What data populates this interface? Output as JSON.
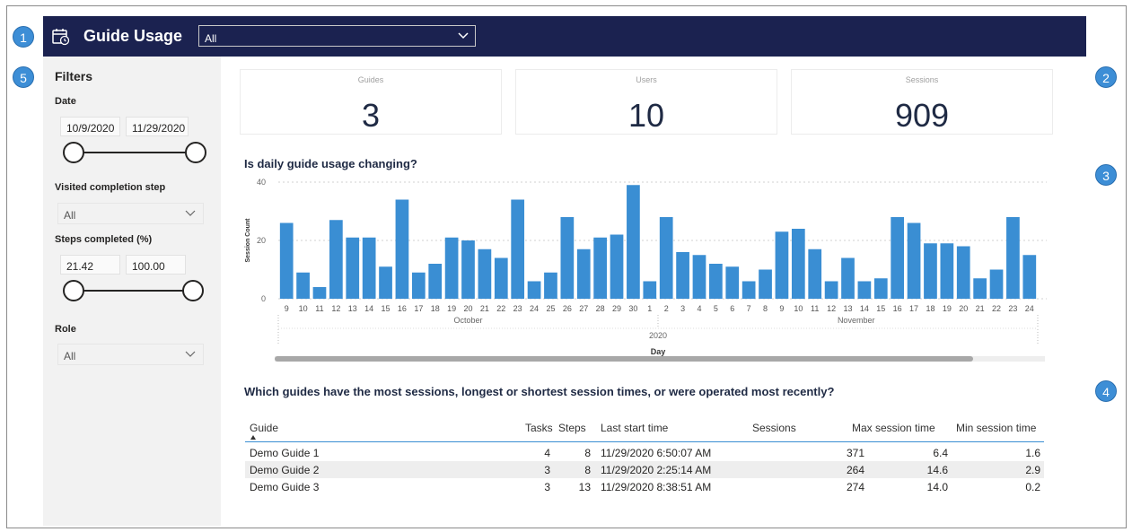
{
  "badges": [
    "1",
    "5",
    "2",
    "3",
    "4"
  ],
  "header": {
    "title": "Guide Usage",
    "select_value": "All"
  },
  "filters": {
    "title": "Filters",
    "date": {
      "label": "Date",
      "start": "10/9/2020",
      "end": "11/29/2020"
    },
    "visited": {
      "label": "Visited completion step",
      "value": "All"
    },
    "steps": {
      "label": "Steps completed (%)",
      "min": "21.42",
      "max": "100.00"
    },
    "role": {
      "label": "Role",
      "value": "All"
    }
  },
  "cards": [
    {
      "label": "Guides",
      "value": "3"
    },
    {
      "label": "Users",
      "value": "10"
    },
    {
      "label": "Sessions",
      "value": "909"
    }
  ],
  "chart_section": {
    "title": "Is daily guide usage changing?"
  },
  "chart_data": {
    "type": "bar",
    "ylabel": "Session Count",
    "xlabel": "Day",
    "ylim": [
      0,
      40
    ],
    "yticks": [
      0,
      20,
      40
    ],
    "grid": true,
    "year_label": "2020",
    "months": [
      {
        "label": "October",
        "from": 0,
        "to": 22
      },
      {
        "label": "November",
        "from": 23,
        "to": 46
      }
    ],
    "categories": [
      "9",
      "10",
      "11",
      "12",
      "13",
      "14",
      "15",
      "16",
      "17",
      "18",
      "19",
      "20",
      "21",
      "22",
      "23",
      "24",
      "25",
      "26",
      "27",
      "28",
      "29",
      "30",
      "1",
      "2",
      "3",
      "4",
      "5",
      "6",
      "7",
      "8",
      "9",
      "10",
      "11",
      "12",
      "13",
      "14",
      "15",
      "16",
      "17",
      "18",
      "19",
      "20",
      "21",
      "22",
      "23",
      "24"
    ],
    "values": [
      26,
      9,
      4,
      27,
      21,
      21,
      11,
      34,
      9,
      12,
      21,
      20,
      17,
      14,
      34,
      6,
      9,
      28,
      17,
      21,
      22,
      39,
      6,
      28,
      16,
      15,
      12,
      11,
      6,
      10,
      23,
      24,
      17,
      6,
      14,
      6,
      7,
      28,
      26,
      19,
      19,
      18,
      7,
      10,
      28,
      15
    ],
    "color": "#3a8ed3"
  },
  "table_section": {
    "title": "Which guides have the most sessions, longest or shortest session times, or were operated most recently?"
  },
  "table": {
    "headers": [
      "Guide",
      "Tasks",
      "Steps",
      "Last start time",
      "Sessions",
      "Max session time",
      "Min session time"
    ],
    "rows": [
      [
        "Demo Guide 1",
        "4",
        "8",
        "11/29/2020 6:50:07 AM",
        "371",
        "6.4",
        "1.6"
      ],
      [
        "Demo Guide 2",
        "3",
        "8",
        "11/29/2020 2:25:14 AM",
        "264",
        "14.6",
        "2.9"
      ],
      [
        "Demo Guide 3",
        "3",
        "13",
        "11/29/2020 8:38:51 AM",
        "274",
        "14.0",
        "0.2"
      ]
    ]
  }
}
